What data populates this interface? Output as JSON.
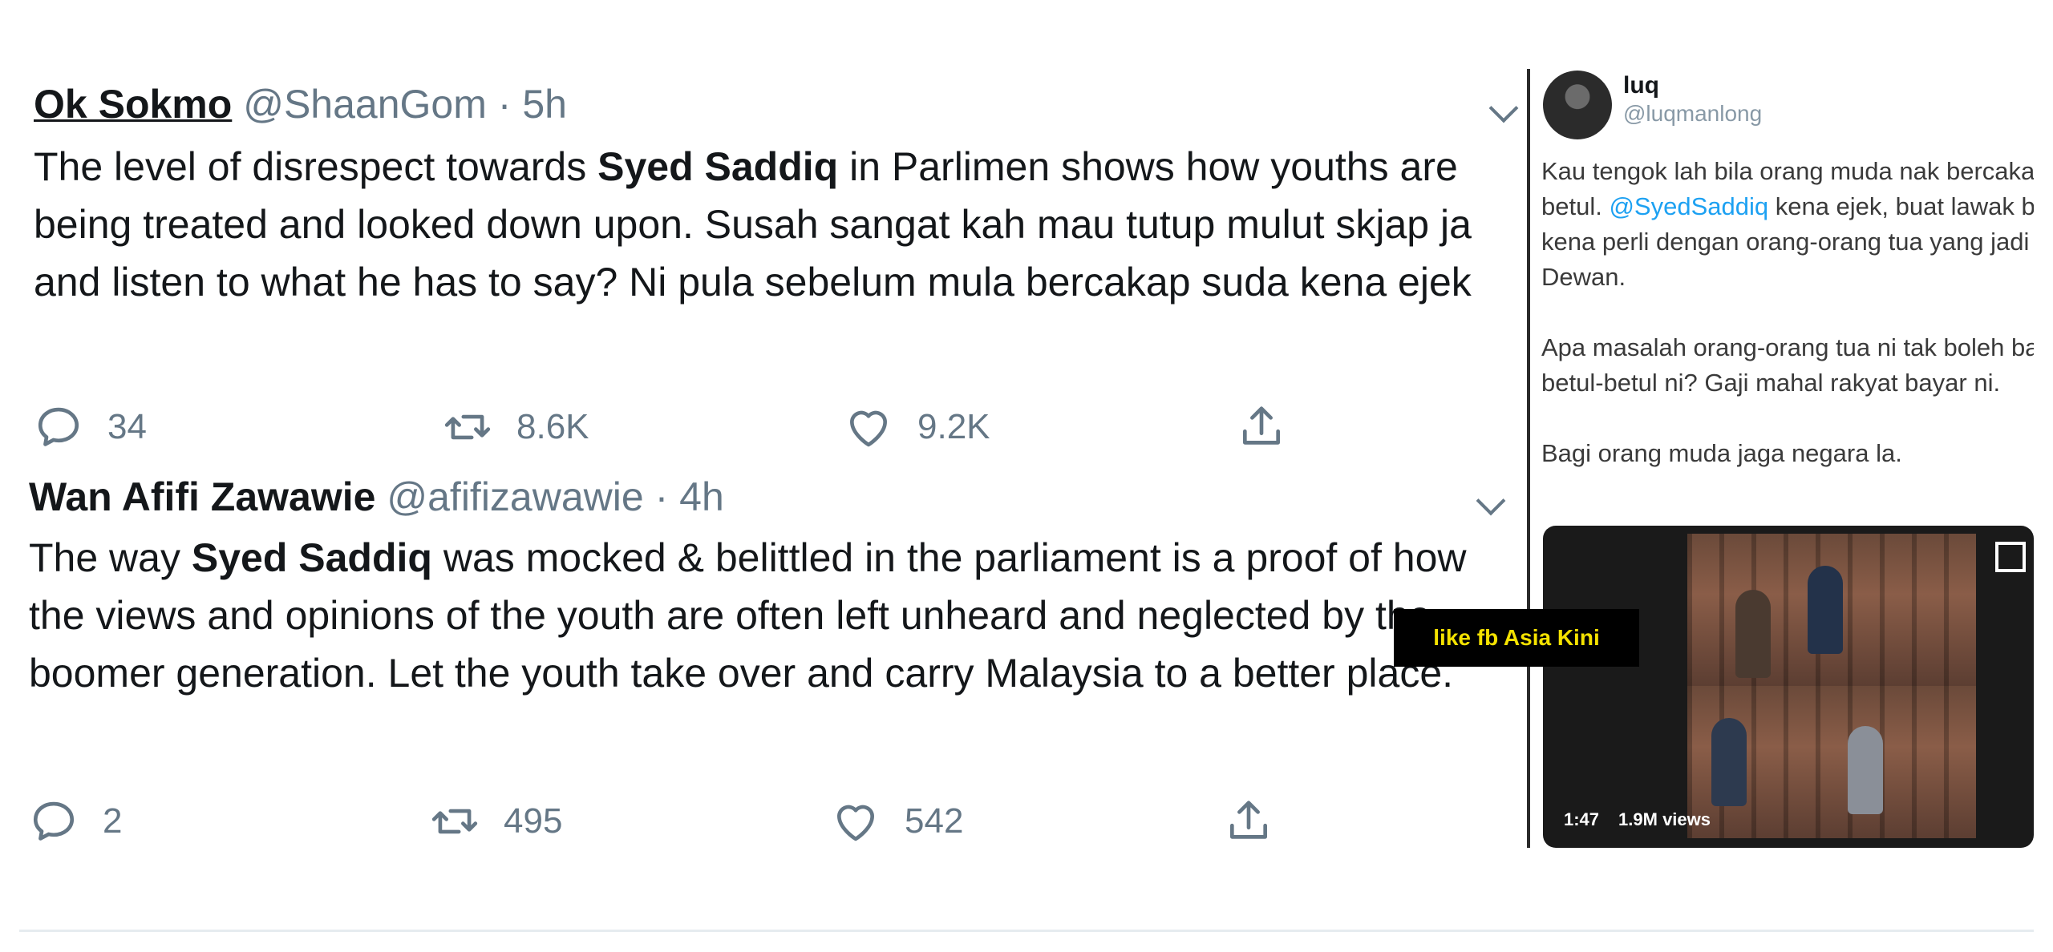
{
  "tweets": [
    {
      "name": "Ok Sokmo",
      "handle": "@ShaanGom",
      "separator": "·",
      "time": "5h",
      "text_before": "The level of disrespect towards ",
      "text_bold": "Syed Saddiq",
      "text_after": " in Parlimen shows how youths are being treated and looked down upon. Susah sangat kah mau tutup mulut skjap ja and listen to what he has to say? Ni pula sebelum mula bercakap suda kena ejek",
      "replies": "34",
      "retweets": "8.6K",
      "likes": "9.2K"
    },
    {
      "name": "Wan Afifi Zawawie",
      "handle": "@afifizawawie",
      "separator": "·",
      "time": "4h",
      "text_before": "The way ",
      "text_bold": "Syed Saddiq",
      "text_after": " was mocked & belittled in the parliament is a proof of how the views and opinions of the youth are often left unheard and neglected by the boomer generation. Let the youth take over and carry Malaysia to a better place.",
      "replies": "2",
      "retweets": "495",
      "likes": "542"
    }
  ],
  "side_tweet": {
    "name": "luq",
    "handle": "@luqmanlong",
    "para1_before": "Kau tengok lah bila orang muda nak bercakap betul-betul. ",
    "para1_mention": "@SyedSaddiq",
    "para1_after": " kena ejek, buat lawak bodo, kena perli dengan orang-orang tua yang jadi ahli Dewan.",
    "para2": "Apa masalah orang-orang tua ni tak boleh bahas betul-betul ni? Gaji mahal rakyat bayar ni.",
    "para3": "Bagi orang muda jaga negara la.",
    "video_duration": "1:47",
    "video_views": "1.9M views"
  },
  "watermark": "like fb Asia Kini",
  "icons": [
    "reply-icon",
    "retweet-icon",
    "like-icon",
    "share-icon",
    "chevron-down-icon"
  ],
  "colors": {
    "text": "#14171a",
    "secondary": "#657786",
    "link": "#1da1f2",
    "badge_bg": "#000000",
    "badge_text": "#f5e200"
  }
}
